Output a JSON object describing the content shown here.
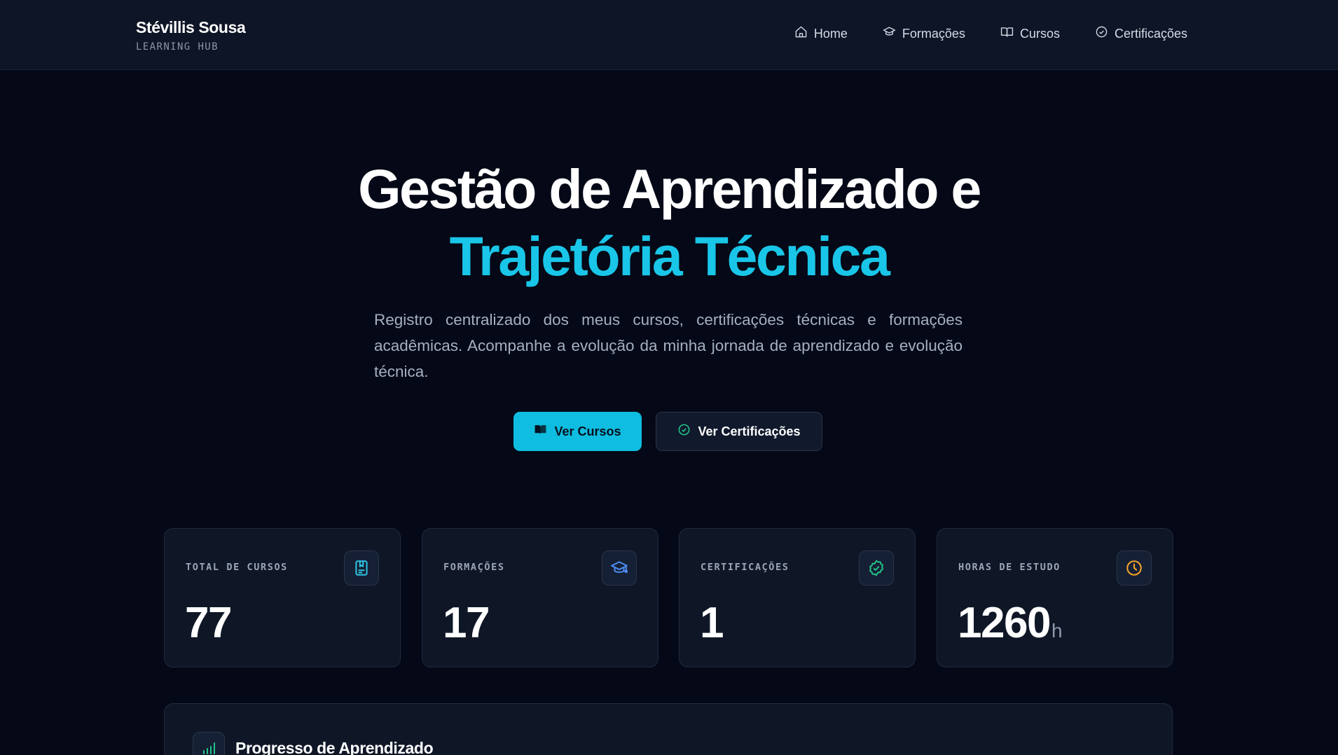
{
  "brand": {
    "name": "Stévillis Sousa",
    "subtitle": "LEARNING HUB"
  },
  "nav": {
    "items": [
      {
        "label": "Home",
        "icon": "home-icon"
      },
      {
        "label": "Formações",
        "icon": "graduation-cap-icon"
      },
      {
        "label": "Cursos",
        "icon": "book-open-icon"
      },
      {
        "label": "Certificações",
        "icon": "badge-check-icon"
      }
    ]
  },
  "hero": {
    "title_line1": "Gestão de Aprendizado e",
    "title_line2": "Trajetória Técnica",
    "description": "Registro centralizado dos meus cursos, certificações técnicas e formações acadêmicas. Acompanhe a evolução da minha jornada de aprendizado e evolução técnica.",
    "primary_cta": "Ver Cursos",
    "secondary_cta": "Ver Certificações"
  },
  "stats": [
    {
      "label": "TOTAL DE CURSOS",
      "value": "77",
      "unit": "",
      "icon": "book-bookmark-icon",
      "color": "#2ec6e8"
    },
    {
      "label": "FORMAÇÕES",
      "value": "17",
      "unit": "",
      "icon": "graduation-cap-icon",
      "color": "#4d8ef7"
    },
    {
      "label": "CERTIFICAÇÕES",
      "value": "1",
      "unit": "",
      "icon": "badge-check-icon",
      "color": "#22c58a"
    },
    {
      "label": "HORAS DE ESTUDO",
      "value": "1260",
      "unit": "h",
      "icon": "clock-icon",
      "color": "#f3a22a"
    }
  ],
  "progress": {
    "title": "Progresso de Aprendizado",
    "icon": "bar-chart-icon",
    "color": "#22c58a"
  },
  "colors": {
    "accent": "#19c6e8",
    "background": "#050816",
    "card": "#0f1727"
  }
}
